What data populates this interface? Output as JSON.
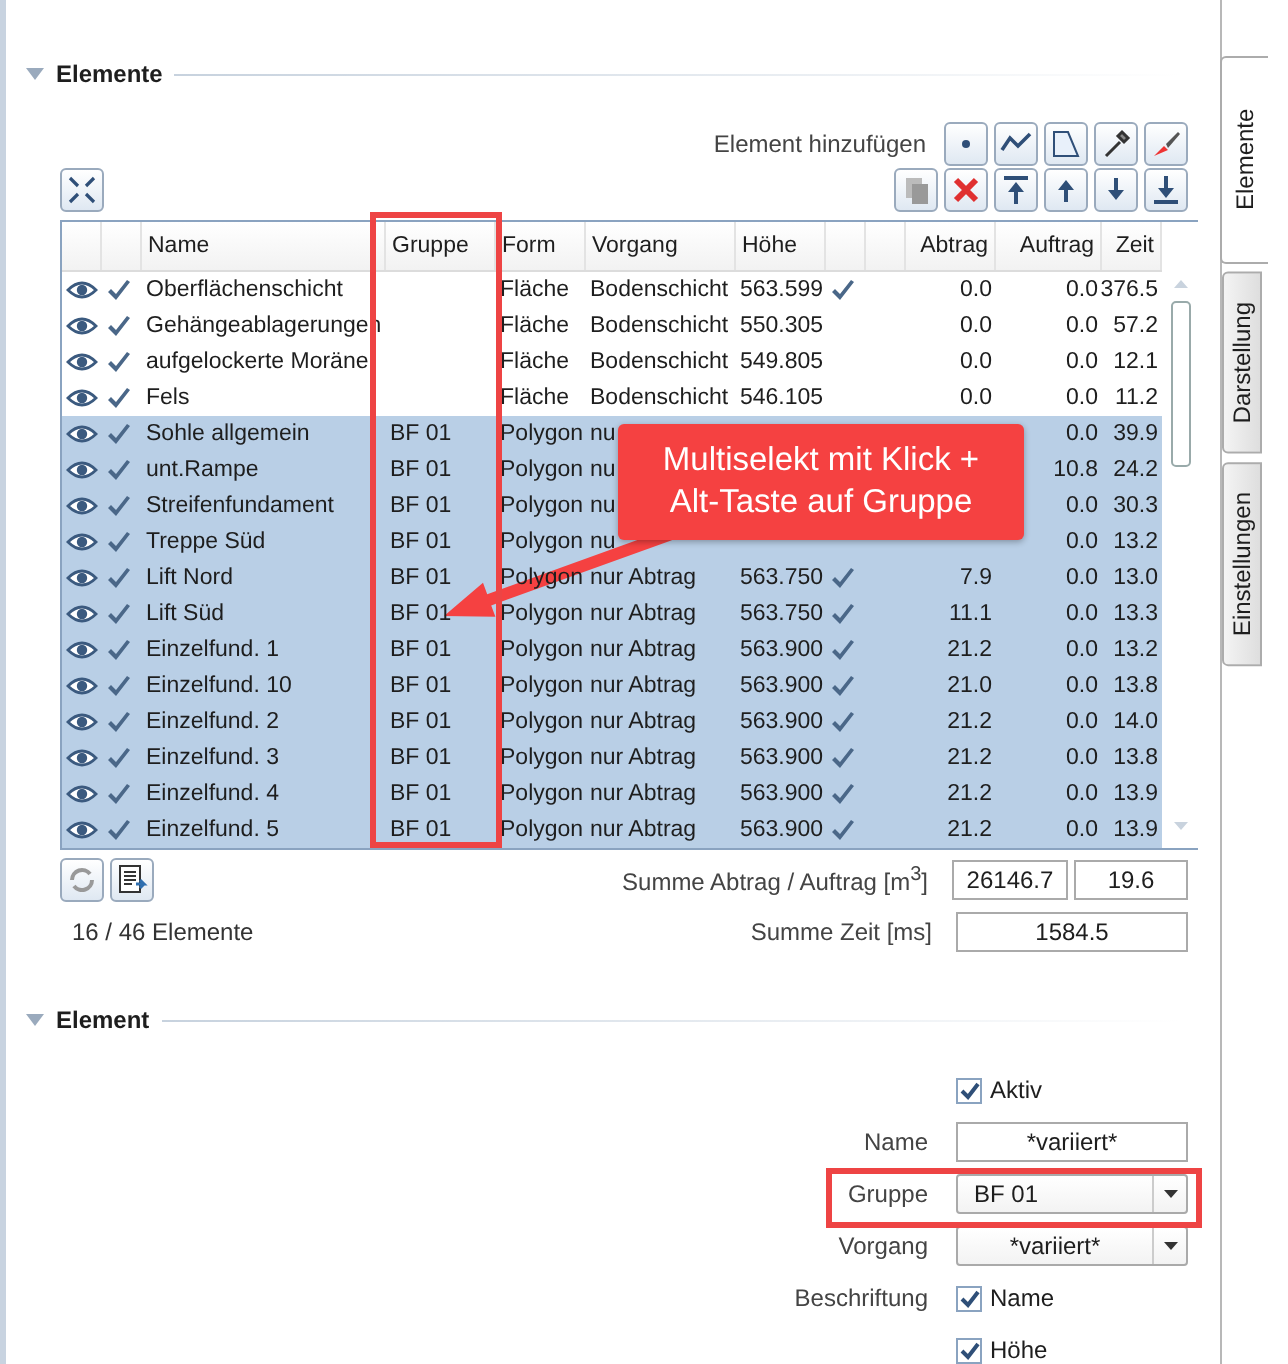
{
  "side_tabs": [
    {
      "label": "Elemente",
      "selected": true
    },
    {
      "label": "Darstellung",
      "selected": false
    },
    {
      "label": "Einstellungen",
      "selected": false
    }
  ],
  "elements_section": {
    "title": "Elemente",
    "expanded": true,
    "add_label": "Element hinzufügen",
    "table": {
      "columns": [
        "Name",
        "Gruppe",
        "Form",
        "Vorgang",
        "Höhe",
        "Abtrag",
        "Auftrag",
        "Zeit"
      ],
      "rows": [
        {
          "name": "Oberflächenschicht",
          "form": "Fläche",
          "vorgang": "Bodenschicht",
          "hoehe": "563.599",
          "fixed": true,
          "abtrag": "0.0",
          "auftrag": "0.0",
          "zeit": "376.5",
          "selected": false
        },
        {
          "name": "Gehängeablagerungen",
          "form": "Fläche",
          "vorgang": "Bodenschicht",
          "hoehe": "550.305",
          "fixed": false,
          "abtrag": "0.0",
          "auftrag": "0.0",
          "zeit": "57.2",
          "selected": false
        },
        {
          "name": "aufgelockerte Moräne",
          "form": "Fläche",
          "vorgang": "Bodenschicht",
          "hoehe": "549.805",
          "fixed": false,
          "abtrag": "0.0",
          "auftrag": "0.0",
          "zeit": "12.1",
          "selected": false
        },
        {
          "name": "Fels",
          "form": "Fläche",
          "vorgang": "Bodenschicht",
          "hoehe": "546.105",
          "fixed": false,
          "abtrag": "0.0",
          "auftrag": "0.0",
          "zeit": "11.2",
          "selected": false
        },
        {
          "name": "Sohle allgemein",
          "gruppe": "BF 01",
          "form": "Polygon",
          "vorgang": "nu",
          "auftrag": "0.0",
          "zeit": "39.9",
          "selected": true
        },
        {
          "name": "unt.Rampe",
          "gruppe": "BF 01",
          "form": "Polygon",
          "vorgang": "nu",
          "auftrag": "10.8",
          "zeit": "24.2",
          "selected": true
        },
        {
          "name": "Streifenfundament",
          "gruppe": "BF 01",
          "form": "Polygon",
          "vorgang": "nu",
          "auftrag": "0.0",
          "zeit": "30.3",
          "selected": true
        },
        {
          "name": "Treppe Süd",
          "gruppe": "BF 01",
          "form": "Polygon",
          "vorgang": "nu",
          "auftrag": "0.0",
          "zeit": "13.2",
          "selected": true
        },
        {
          "name": "Lift Nord",
          "gruppe": "BF 01",
          "form": "Polygon",
          "vorgang": "nur Abtrag",
          "hoehe": "563.750",
          "fixed": true,
          "abtrag": "7.9",
          "auftrag": "0.0",
          "zeit": "13.0",
          "selected": true
        },
        {
          "name": "Lift Süd",
          "gruppe": "BF 01",
          "form": "Polygon",
          "vorgang": "nur Abtrag",
          "hoehe": "563.750",
          "fixed": true,
          "abtrag": "11.1",
          "auftrag": "0.0",
          "zeit": "13.3",
          "selected": true
        },
        {
          "name": "Einzelfund. 1",
          "gruppe": "BF 01",
          "form": "Polygon",
          "vorgang": "nur Abtrag",
          "hoehe": "563.900",
          "fixed": true,
          "abtrag": "21.2",
          "auftrag": "0.0",
          "zeit": "13.2",
          "selected": true
        },
        {
          "name": "Einzelfund. 10",
          "gruppe": "BF 01",
          "form": "Polygon",
          "vorgang": "nur Abtrag",
          "hoehe": "563.900",
          "fixed": true,
          "abtrag": "21.0",
          "auftrag": "0.0",
          "zeit": "13.8",
          "selected": true
        },
        {
          "name": "Einzelfund. 2",
          "gruppe": "BF 01",
          "form": "Polygon",
          "vorgang": "nur Abtrag",
          "hoehe": "563.900",
          "fixed": true,
          "abtrag": "21.2",
          "auftrag": "0.0",
          "zeit": "14.0",
          "selected": true
        },
        {
          "name": "Einzelfund. 3",
          "gruppe": "BF 01",
          "form": "Polygon",
          "vorgang": "nur Abtrag",
          "hoehe": "563.900",
          "fixed": true,
          "abtrag": "21.2",
          "auftrag": "0.0",
          "zeit": "13.8",
          "selected": true
        },
        {
          "name": "Einzelfund. 4",
          "gruppe": "BF 01",
          "form": "Polygon",
          "vorgang": "nur Abtrag",
          "hoehe": "563.900",
          "fixed": true,
          "abtrag": "21.2",
          "auftrag": "0.0",
          "zeit": "13.9",
          "selected": true
        },
        {
          "name": "Einzelfund. 5",
          "gruppe": "BF 01",
          "form": "Polygon",
          "vorgang": "nur Abtrag",
          "hoehe": "563.900",
          "fixed": true,
          "abtrag": "21.2",
          "auftrag": "0.0",
          "zeit": "13.9",
          "selected": true
        }
      ]
    },
    "sum_label": "Summe Abtrag / Auftrag [m$^{3}$]",
    "sum_abtrag": "26146.7",
    "sum_auftrag": "19.6",
    "count": "16 / 46 Elemente",
    "time_label": "Summe Zeit [ms]",
    "time_value": "1584.5"
  },
  "element_section": {
    "title": "Element",
    "expanded": true,
    "aktiv": {
      "label": "Aktiv",
      "checked": true
    },
    "name": {
      "label": "Name",
      "value": "*variiert*"
    },
    "gruppe": {
      "label": "Gruppe",
      "value": "BF 01"
    },
    "vorgang": {
      "label": "Vorgang",
      "value": "*variiert*"
    },
    "beschriftung": {
      "label": "Beschriftung",
      "options": [
        {
          "label": "Name",
          "checked": true
        },
        {
          "label": "Höhe",
          "checked": true
        }
      ]
    }
  },
  "annotation": {
    "text": "Multiselekt mit Klick + Alt-Taste auf Gruppe"
  }
}
